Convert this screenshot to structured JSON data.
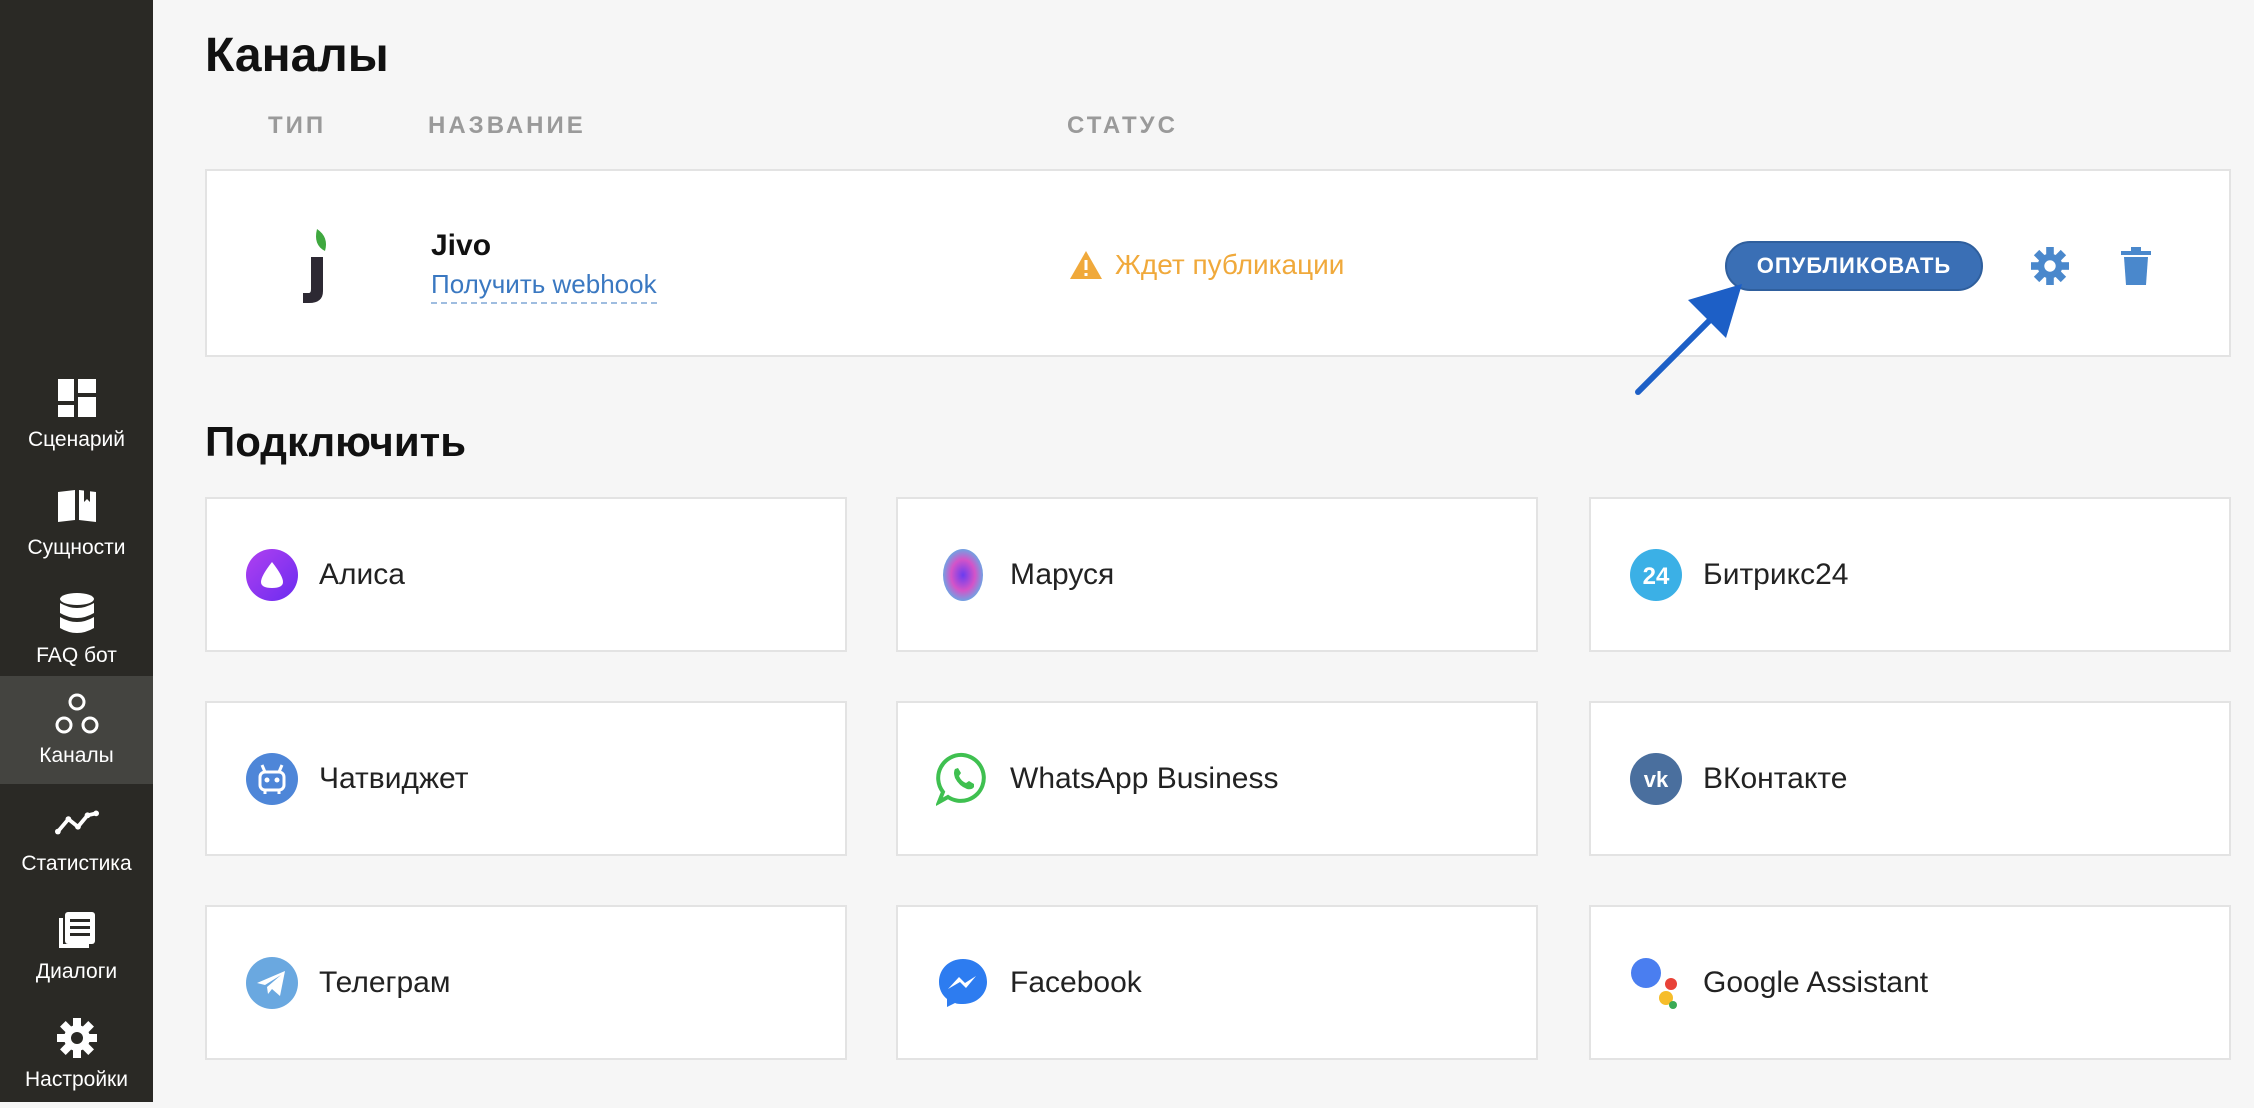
{
  "sidebar": {
    "items": [
      {
        "label": "Сценарий",
        "icon": "dashboard-icon"
      },
      {
        "label": "Сущности",
        "icon": "book-icon"
      },
      {
        "label": "FAQ бот",
        "icon": "database-icon"
      },
      {
        "label": "Каналы",
        "icon": "channels-icon",
        "active": true
      },
      {
        "label": "Статистика",
        "icon": "chart-line-icon"
      },
      {
        "label": "Диалоги",
        "icon": "dialogs-icon"
      },
      {
        "label": "Настройки",
        "icon": "gear-icon"
      }
    ]
  },
  "page": {
    "title": "Каналы"
  },
  "table": {
    "headers": {
      "type": "ТИП",
      "name": "НАЗВАНИЕ",
      "status": "СТАТУС"
    },
    "rows": [
      {
        "name": "Jivo",
        "link": "Получить webhook",
        "status": "Ждет публикации",
        "action": "ОПУБЛИКОВАТЬ"
      }
    ]
  },
  "connect": {
    "title": "Подключить",
    "cards": [
      {
        "label": "Алиса",
        "icon": "alice-icon"
      },
      {
        "label": "Маруся",
        "icon": "marusya-icon"
      },
      {
        "label": "Битрикс24",
        "icon": "bitrix24-icon"
      },
      {
        "label": "Чатвиджет",
        "icon": "chatwidget-icon"
      },
      {
        "label": "WhatsApp Business",
        "icon": "whatsapp-icon"
      },
      {
        "label": "ВКонтакте",
        "icon": "vk-icon"
      },
      {
        "label": "Телеграм",
        "icon": "telegram-icon"
      },
      {
        "label": "Facebook",
        "icon": "messenger-icon"
      },
      {
        "label": "Google Assistant",
        "icon": "google-assistant-icon"
      }
    ]
  },
  "colors": {
    "sidebar_bg": "#2a2925",
    "accent": "#3a6fb5",
    "warning": "#f0a93b"
  }
}
